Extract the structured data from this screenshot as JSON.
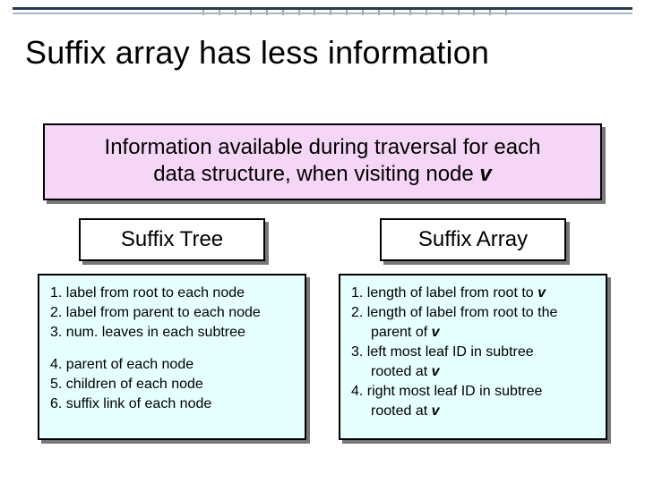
{
  "title": "Suffix array has less information",
  "subtitle": {
    "line1": "Information available during traversal for each",
    "line2_pre": "data structure, when visiting node ",
    "line2_em": "v"
  },
  "left": {
    "heading": "Suffix Tree",
    "items_a": [
      "1. label from root to each node",
      "2. label from parent to each node",
      "3. num. leaves in each subtree"
    ],
    "items_b": [
      "4. parent of each node",
      "5. children of each node",
      "6. suffix link of each node"
    ]
  },
  "right": {
    "heading": "Suffix Array",
    "lines": [
      {
        "type": "num",
        "pre": "1.  length of label from root to ",
        "em": "v"
      },
      {
        "type": "num",
        "pre": "2.  length of label from root to the",
        "em": ""
      },
      {
        "type": "cont",
        "pre": "parent of ",
        "em": "v"
      },
      {
        "type": "num",
        "pre": "3.  left most leaf ID in subtree",
        "em": ""
      },
      {
        "type": "cont",
        "pre": "rooted at ",
        "em": "v"
      },
      {
        "type": "num",
        "pre": "4.  right most leaf ID in subtree",
        "em": ""
      },
      {
        "type": "cont",
        "pre": "rooted at ",
        "em": "v"
      }
    ]
  }
}
